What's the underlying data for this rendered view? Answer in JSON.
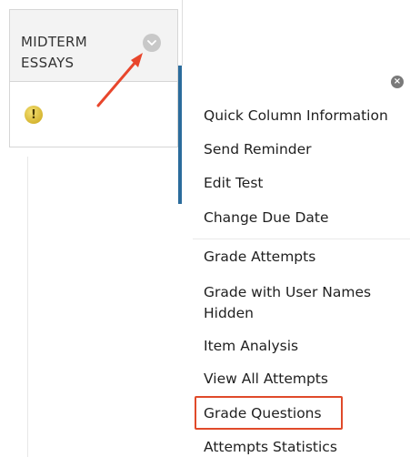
{
  "column": {
    "title": "MIDTERM\nESSAYS"
  },
  "icons": {
    "chevron": "chevron-down-icon",
    "warning": "exclamation-icon",
    "close": "close-icon",
    "arrow": "annotation-arrow"
  },
  "colors": {
    "arrow": "#e8462c",
    "highlight": "#e04a2a",
    "accent_bar": "#2b6c9c"
  },
  "menu": {
    "items": [
      "Quick Column Information",
      "Send Reminder",
      "Edit Test",
      "Change Due Date",
      "Grade Attempts",
      "Grade with User Names\nHidden",
      "Item Analysis",
      "View All Attempts",
      "Grade Questions",
      "Attempts Statistics"
    ]
  }
}
